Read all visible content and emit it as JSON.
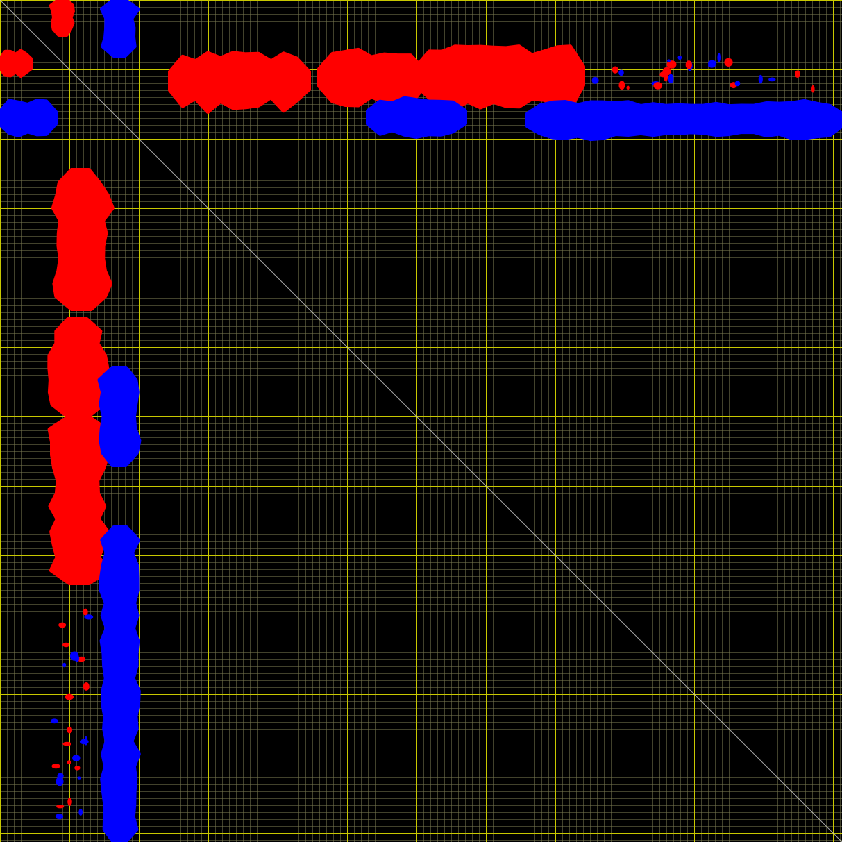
{
  "chart_data": {
    "type": "heatmap",
    "title": "",
    "xlabel": "",
    "ylabel": "",
    "grid": true,
    "diagonal_line": true,
    "colors": {
      "background": "#000000",
      "positive": "#ff0000",
      "negative": "#0000ff",
      "major_grid": "#c8c800",
      "minor_grid": "#787850",
      "diagonal": "#cccccc"
    },
    "axis_range": [
      0,
      1213
    ],
    "bands": [
      {
        "name": "red-vertical-upper",
        "sign": "positive",
        "orientation": "vertical",
        "range": [
          0,
          50
        ],
        "span": [
          75,
          105
        ]
      },
      {
        "name": "blue-vertical-upper",
        "sign": "negative",
        "orientation": "vertical",
        "range": [
          0,
          80
        ],
        "span": [
          148,
          196
        ]
      },
      {
        "name": "red-horizontal-upper-left",
        "sign": "positive",
        "orientation": "horizontal",
        "range": [
          0,
          45
        ],
        "span": [
          75,
          108
        ]
      },
      {
        "name": "blue-horizontal-left",
        "sign": "negative",
        "orientation": "horizontal",
        "range": [
          0,
          80
        ],
        "span": [
          145,
          195
        ]
      },
      {
        "name": "red-horizontal-1",
        "sign": "positive",
        "orientation": "horizontal",
        "range": [
          245,
          445
        ],
        "span": [
          80,
          152
        ]
      },
      {
        "name": "red-horizontal-2",
        "sign": "positive",
        "orientation": "horizontal",
        "range": [
          460,
          610
        ],
        "span": [
          75,
          150
        ]
      },
      {
        "name": "red-horizontal-3",
        "sign": "positive",
        "orientation": "horizontal",
        "range": [
          600,
          840
        ],
        "span": [
          70,
          150
        ]
      },
      {
        "name": "blue-horizontal-center",
        "sign": "negative",
        "orientation": "horizontal",
        "range": [
          530,
          670
        ],
        "span": [
          143,
          195
        ]
      },
      {
        "name": "blue-horizontal-right",
        "sign": "negative",
        "orientation": "horizontal",
        "range": [
          760,
          1213
        ],
        "span": [
          148,
          197
        ]
      },
      {
        "name": "red-vertical-1",
        "sign": "positive",
        "orientation": "vertical",
        "range": [
          245,
          445
        ],
        "span": [
          78,
          155
        ]
      },
      {
        "name": "red-vertical-2",
        "sign": "positive",
        "orientation": "vertical",
        "range": [
          460,
          600
        ],
        "span": [
          72,
          152
        ]
      },
      {
        "name": "red-vertical-3",
        "sign": "positive",
        "orientation": "vertical",
        "range": [
          600,
          840
        ],
        "span": [
          75,
          152
        ]
      },
      {
        "name": "blue-vertical-mid",
        "sign": "negative",
        "orientation": "vertical",
        "range": [
          530,
          670
        ],
        "span": [
          145,
          198
        ]
      },
      {
        "name": "blue-vertical-lower",
        "sign": "negative",
        "orientation": "vertical",
        "range": [
          760,
          1213
        ],
        "span": [
          148,
          197
        ]
      }
    ]
  }
}
